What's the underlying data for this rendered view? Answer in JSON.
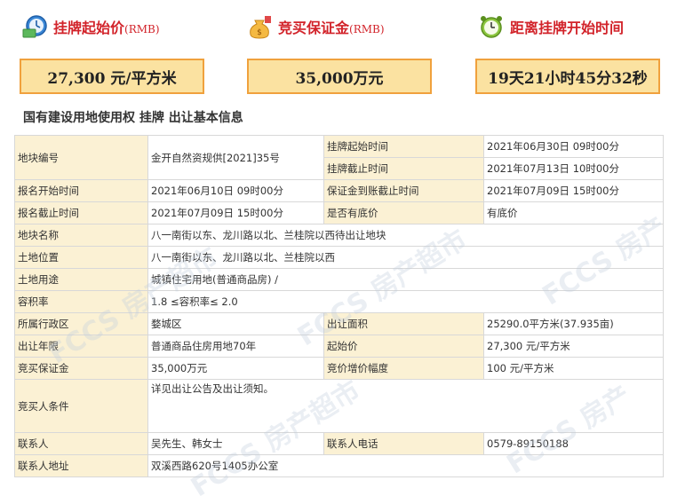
{
  "header": {
    "start_price_label": "挂牌起始价",
    "start_price_unit": "(RMB)",
    "start_price_value": "27,300 元/平方米",
    "deposit_label": "竞买保证金",
    "deposit_unit": "(RMB)",
    "deposit_value": "35,000万元",
    "countdown_label": "距离挂牌开始时间",
    "countdown_value": "19天21小时45分32秒"
  },
  "subtitle": "国有建设用地使用权 挂牌 出让基本信息",
  "table": {
    "parcel_no_label": "地块编号",
    "parcel_no": "金开自然资规供[2021]35号",
    "listing_start_label": "挂牌起始时间",
    "listing_start": "2021年06月30日 09时00分",
    "listing_end_label": "挂牌截止时间",
    "listing_end": "2021年07月13日 10时00分",
    "reg_start_label": "报名开始时间",
    "reg_start": "2021年06月10日 09时00分",
    "deposit_deadline_label": "保证金到账截止时间",
    "deposit_deadline": "2021年07月09日 15时00分",
    "reg_end_label": "报名截止时间",
    "reg_end": "2021年07月09日 15时00分",
    "reserve_label": "是否有底价",
    "reserve": "有底价",
    "name_label": "地块名称",
    "name": "八一南街以东、龙川路以北、兰桂院以西待出让地块",
    "location_label": "土地位置",
    "location": "八一南街以东、龙川路以北、兰桂院以西",
    "usage_label": "土地用途",
    "usage": "城镇住宅用地(普通商品房) /",
    "far_label": "容积率",
    "far": "1.8 ≤容积率≤ 2.0",
    "district_label": "所属行政区",
    "district": "婺城区",
    "area_label": "出让面积",
    "area": "25290.0平方米(37.935亩)",
    "term_label": "出让年限",
    "term": "普通商品住房用地70年",
    "start_price_label": "起始价",
    "start_price": "27,300 元/平方米",
    "deposit_label": "竞买保证金",
    "deposit": "35,000万元",
    "increment_label": "竞价增价幅度",
    "increment": "100 元/平方米",
    "conditions_label": "竞买人条件",
    "conditions": "详见出让公告及出让须知。",
    "contact_label": "联系人",
    "contact": "吴先生、韩女士",
    "phone_label": "联系人电话",
    "phone": "0579-89150188",
    "address_label": "联系人地址",
    "address": "双溪西路620号1405办公室"
  },
  "colors": {
    "accent_red": "#d2232a",
    "box_fill": "#fbe2a1",
    "box_border": "#f0a13d",
    "key_cell": "#fbf1d4"
  },
  "icons": [
    "clock-money-icon",
    "money-bag-icon",
    "alarm-clock-icon"
  ]
}
